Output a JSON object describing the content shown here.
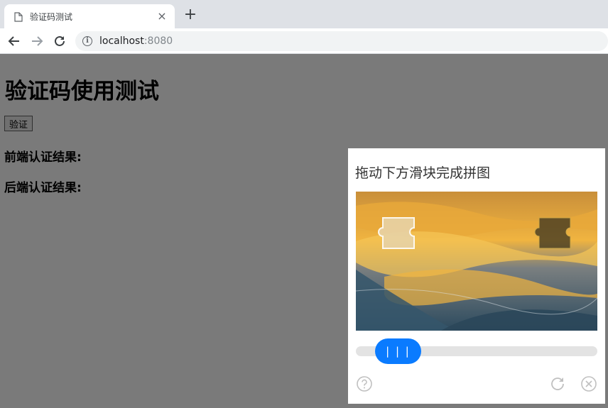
{
  "browser": {
    "tab_title": "验证码测试",
    "tab_close": "×",
    "newtab": "+",
    "url_host": "localhost",
    "url_port": ":8080",
    "info_glyph": "i"
  },
  "page": {
    "title": "验证码使用测试",
    "verify_button": "验证",
    "front_result_label": "前端认证结果:",
    "back_result_label": "后端认证结果:"
  },
  "captcha": {
    "title": "拖动下方滑块完成拼图",
    "handle_label": "| | |",
    "slider_progress": 0.08
  },
  "colors": {
    "accent": "#0a7bff",
    "overlay": "#7a7a7a",
    "track": "#e3e3e3"
  },
  "icons": [
    "doc-icon",
    "back-arrow-icon",
    "forward-arrow-icon",
    "reload-icon",
    "info-icon",
    "help-icon",
    "refresh-icon",
    "close-circle-icon"
  ]
}
